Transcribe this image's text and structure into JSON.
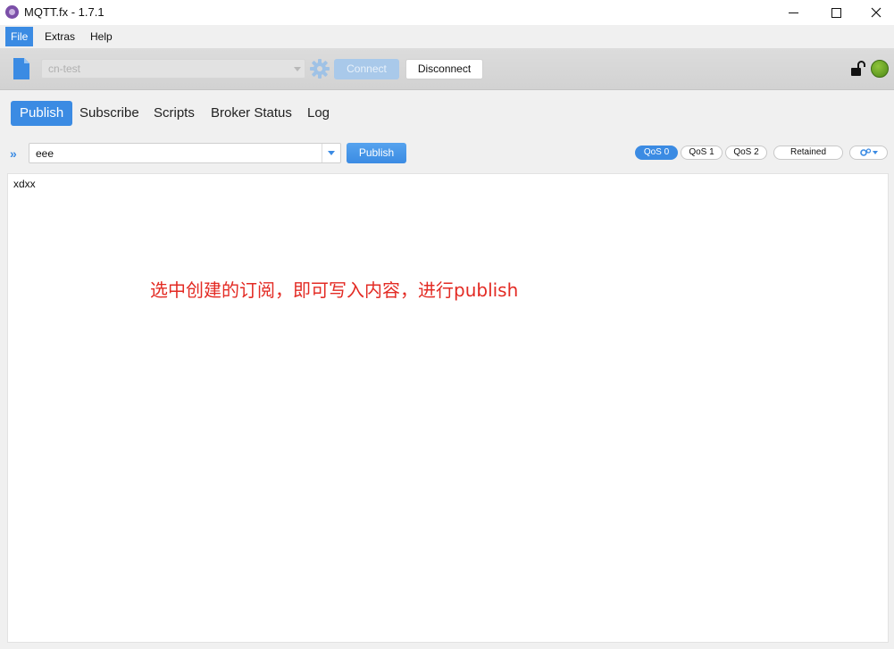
{
  "window": {
    "title": "MQTT.fx - 1.7.1"
  },
  "menu": {
    "items": [
      "File",
      "Extras",
      "Help"
    ]
  },
  "connection": {
    "profile": "cn-test",
    "connect_label": "Connect",
    "disconnect_label": "Disconnect",
    "status_color": "#6aa82a"
  },
  "tabs": [
    "Publish",
    "Subscribe",
    "Scripts",
    "Broker Status",
    "Log"
  ],
  "publish": {
    "topic": "eee",
    "button_label": "Publish",
    "qos": [
      "QoS 0",
      "QoS 1",
      "QoS 2"
    ],
    "qos_selected": "QoS 0",
    "retained_label": "Retained",
    "message": "xdxx"
  },
  "annotation": "选中创建的订阅，即可写入内容，进行publish",
  "colors": {
    "accent": "#3b8be3",
    "annotation": "#e32b24"
  }
}
